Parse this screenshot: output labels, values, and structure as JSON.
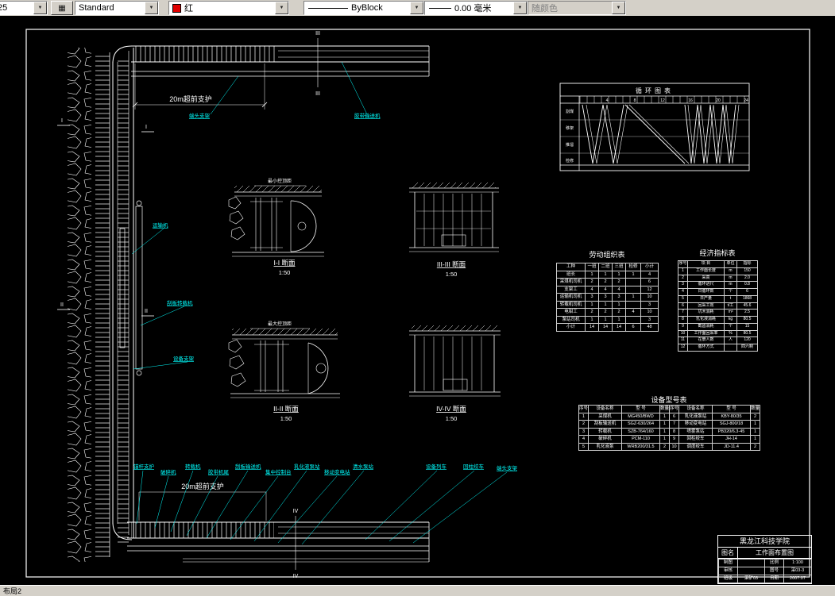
{
  "toolbar": {
    "snap_value": "25",
    "text_style": "Standard",
    "color": "红",
    "linetype": "ByBlock",
    "lineweight": "0.00 毫米",
    "plot_style": "随颜色"
  },
  "statusbar": {
    "layout_tab": "布局2"
  },
  "drawing": {
    "dim_top": "20m超前支护",
    "dim_bottom": "20m超前支护",
    "cut_marks": {
      "c1": "I",
      "c2": "II",
      "c3": "III",
      "c4": "IV"
    },
    "left_labels": {
      "end_support": "端头支架",
      "belt_conveyor": "胶带输送机",
      "conveyor": "运输机",
      "loader": "刮板转载机",
      "equip_support": "设备支架"
    },
    "bottom_labels": [
      "锚杆支护",
      "破碎机",
      "转载机",
      "胶带机尾",
      "刮板输送机",
      "集中控制台",
      "乳化液泵站",
      "移动变电站",
      "清水泵站",
      "设备列车",
      "回柱绞车",
      "端头支架"
    ],
    "sections": {
      "s1": {
        "name": "I-I 断面",
        "scale": "1:50",
        "note": "最小控顶距"
      },
      "s2": {
        "name": "III-III 断面",
        "scale": "1:50"
      },
      "s3": {
        "name": "II-II 断面",
        "scale": "1:50",
        "note": "最大控顶距"
      },
      "s4": {
        "name": "IV-IV 断面",
        "scale": "1:50"
      }
    },
    "cycle_chart": {
      "title": "循环图表",
      "ops": [
        "割煤",
        "移架",
        "推溜",
        "检修"
      ],
      "ticks": [
        "4",
        "8",
        "12",
        "16",
        "20",
        "24"
      ]
    },
    "tables": {
      "labor": {
        "title": "劳动组织表",
        "rows": [
          [
            "工种",
            "一班",
            "二班",
            "三班",
            "检修",
            "小计"
          ],
          [
            "班长",
            "1",
            "1",
            "1",
            "1",
            "4"
          ],
          [
            "采煤机司机",
            "2",
            "2",
            "2",
            "",
            "6"
          ],
          [
            "支架工",
            "4",
            "4",
            "4",
            "",
            "12"
          ],
          [
            "运输机司机",
            "3",
            "3",
            "3",
            "1",
            "10"
          ],
          [
            "转载机司机",
            "1",
            "1",
            "1",
            "",
            "3"
          ],
          [
            "电钳工",
            "2",
            "2",
            "2",
            "4",
            "10"
          ],
          [
            "泵站司机",
            "1",
            "1",
            "1",
            "",
            "3"
          ],
          [
            "小计",
            "14",
            "14",
            "14",
            "6",
            "48"
          ]
        ]
      },
      "economic": {
        "title": "经济指标表",
        "rows": [
          [
            "序号",
            "项 目",
            "单位",
            "指标"
          ],
          [
            "1",
            "工作面长度",
            "m",
            "150"
          ],
          [
            "2",
            "采高",
            "m",
            "2.0"
          ],
          [
            "3",
            "循环进尺",
            "m",
            "0.8"
          ],
          [
            "4",
            "日循环数",
            "个",
            "6"
          ],
          [
            "5",
            "日产量",
            "t",
            "1868"
          ],
          [
            "6",
            "回采工效",
            "t/工",
            "45.6"
          ],
          [
            "7",
            "坑木消耗",
            "m³",
            "2.5"
          ],
          [
            "8",
            "乳化液消耗",
            "kg",
            "80.5"
          ],
          [
            "9",
            "截齿消耗",
            "个",
            "15"
          ],
          [
            "10",
            "工作面回采率",
            "%",
            "80.5"
          ],
          [
            "11",
            "在册人数",
            "人",
            "120"
          ],
          [
            "12",
            "循环方式",
            "",
            "四六制"
          ]
        ]
      },
      "equipment": {
        "title": "设备型号表",
        "rows": [
          [
            "序号",
            "设备名称",
            "型 号",
            "数量",
            "序号",
            "设备名称",
            "型 号",
            "数量"
          ],
          [
            "1",
            "采煤机",
            "MG450/BWD",
            "1",
            "6",
            "乳化液泵站",
            "KBY-80/35",
            "2"
          ],
          [
            "2",
            "刮板输送机",
            "SGZ-630/264",
            "1",
            "7",
            "移动变电站",
            "SGJ-800/18",
            "1"
          ],
          [
            "3",
            "转载机",
            "SZB-764/160",
            "1",
            "8",
            "喷雾泵站",
            "PB320/6.3-45",
            "1"
          ],
          [
            "4",
            "破碎机",
            "PCM-110",
            "1",
            "9",
            "回柱绞车",
            "JH-14",
            "1"
          ],
          [
            "5",
            "乳化液泵",
            "WRB200/31.5",
            "2",
            "10",
            "调度绞车",
            "JD-11.4",
            "2"
          ]
        ]
      }
    },
    "title_block": {
      "school": "黑龙江科技学院",
      "name_label": "图名",
      "name": "工作面布置图",
      "rows": [
        [
          "制图",
          "",
          "比例",
          "1:100"
        ],
        [
          "审核",
          "",
          "图号",
          "采03-3"
        ],
        [
          "班级",
          "采矿03",
          "日期",
          "2007.07"
        ]
      ]
    }
  }
}
